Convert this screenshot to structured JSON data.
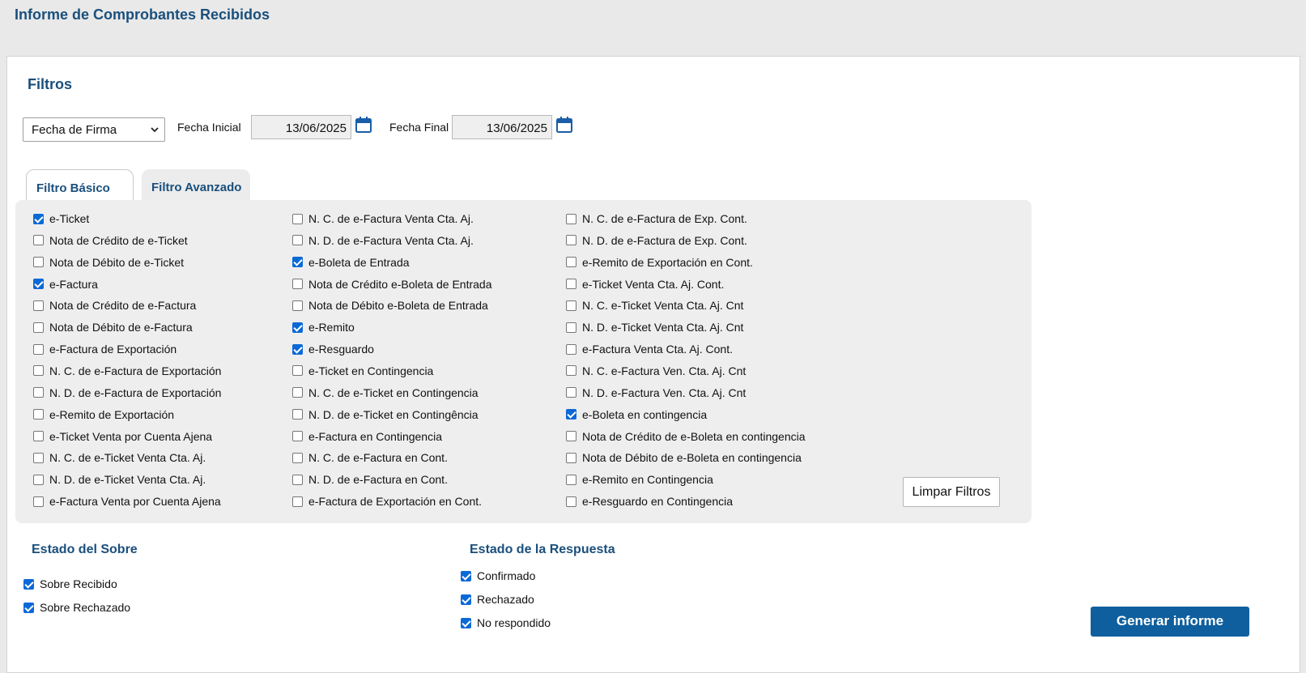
{
  "header": {
    "title": "Informe de Comprobantes Recibidos"
  },
  "filters": {
    "title": "Filtros",
    "date_type": "Fecha de Firma",
    "start_label": "Fecha Inicial",
    "start_value": "13/06/2025",
    "end_label": "Fecha Final",
    "end_value": "13/06/2025"
  },
  "tabs": {
    "basic": "Filtro Básico",
    "advanced": "Filtro Avanzado"
  },
  "doc_types": {
    "col1": [
      {
        "label": "e-Ticket",
        "checked": true
      },
      {
        "label": "Nota de Crédito de e-Ticket",
        "checked": false
      },
      {
        "label": "Nota de Débito de e-Ticket",
        "checked": false
      },
      {
        "label": "e-Factura",
        "checked": true
      },
      {
        "label": "Nota de Crédito de e-Factura",
        "checked": false
      },
      {
        "label": "Nota de Débito de e-Factura",
        "checked": false
      },
      {
        "label": "e-Factura de Exportación",
        "checked": false
      },
      {
        "label": "N. C. de e-Factura de Exportación",
        "checked": false
      },
      {
        "label": "N. D. de e-Factura de Exportación",
        "checked": false
      },
      {
        "label": "e-Remito de Exportación",
        "checked": false
      },
      {
        "label": "e-Ticket Venta por Cuenta Ajena",
        "checked": false
      },
      {
        "label": "N. C. de e-Ticket Venta Cta. Aj.",
        "checked": false
      },
      {
        "label": "N. D. de e-Ticket Venta Cta. Aj.",
        "checked": false
      },
      {
        "label": "e-Factura Venta por Cuenta Ajena",
        "checked": false
      }
    ],
    "col2": [
      {
        "label": "N. C. de e-Factura Venta Cta. Aj.",
        "checked": false
      },
      {
        "label": "N. D. de e-Factura Venta Cta. Aj.",
        "checked": false
      },
      {
        "label": "e-Boleta de Entrada",
        "checked": true
      },
      {
        "label": "Nota de Crédito e-Boleta de Entrada",
        "checked": false
      },
      {
        "label": "Nota de Débito e-Boleta de Entrada",
        "checked": false
      },
      {
        "label": "e-Remito",
        "checked": true
      },
      {
        "label": "e-Resguardo",
        "checked": true
      },
      {
        "label": "e-Ticket en Contingencia",
        "checked": false
      },
      {
        "label": "N. C. de e-Ticket en Contingencia",
        "checked": false
      },
      {
        "label": "N. D. de e-Ticket en Contingência",
        "checked": false
      },
      {
        "label": "e-Factura en Contingencia",
        "checked": false
      },
      {
        "label": "N. C. de e-Factura en Cont.",
        "checked": false
      },
      {
        "label": "N. D. de e-Factura en Cont.",
        "checked": false
      },
      {
        "label": "e-Factura de Exportación en Cont.",
        "checked": false
      }
    ],
    "col3": [
      {
        "label": "N. C. de e-Factura de Exp. Cont.",
        "checked": false
      },
      {
        "label": "N. D. de e-Factura de Exp. Cont.",
        "checked": false
      },
      {
        "label": "e-Remito de Exportación en Cont.",
        "checked": false
      },
      {
        "label": "e-Ticket Venta Cta. Aj. Cont.",
        "checked": false
      },
      {
        "label": "N. C. e-Ticket Venta Cta. Aj. Cnt",
        "checked": false
      },
      {
        "label": "N. D. e-Ticket Venta Cta. Aj. Cnt",
        "checked": false
      },
      {
        "label": "e-Factura Venta Cta. Aj. Cont.",
        "checked": false
      },
      {
        "label": "N. C. e-Factura Ven. Cta. Aj. Cnt",
        "checked": false
      },
      {
        "label": "N. D. e-Factura Ven. Cta. Aj. Cnt",
        "checked": false
      },
      {
        "label": "e-Boleta en contingencia",
        "checked": true
      },
      {
        "label": "Nota de Crédito de e-Boleta en contingencia",
        "checked": false
      },
      {
        "label": "Nota de Débito de e-Boleta en contingencia",
        "checked": false
      },
      {
        "label": "e-Remito en Contingencia",
        "checked": false
      },
      {
        "label": "e-Resguardo en Contingencia",
        "checked": false
      }
    ],
    "clear_label": "Limpar Filtros"
  },
  "envelope_state": {
    "title": "Estado del Sobre",
    "items": [
      {
        "label": "Sobre Recibido",
        "checked": true
      },
      {
        "label": "Sobre Rechazado",
        "checked": true
      }
    ]
  },
  "response_state": {
    "title": "Estado de la Respuesta",
    "items": [
      {
        "label": "Confirmado",
        "checked": true
      },
      {
        "label": "Rechazado",
        "checked": true
      },
      {
        "label": "No respondido",
        "checked": true
      }
    ]
  },
  "actions": {
    "generate_label": "Generar informe"
  },
  "colors": {
    "accent": "#1a4f7c",
    "primary_button": "#0f5f9e",
    "checkbox": "#0b69d6"
  }
}
